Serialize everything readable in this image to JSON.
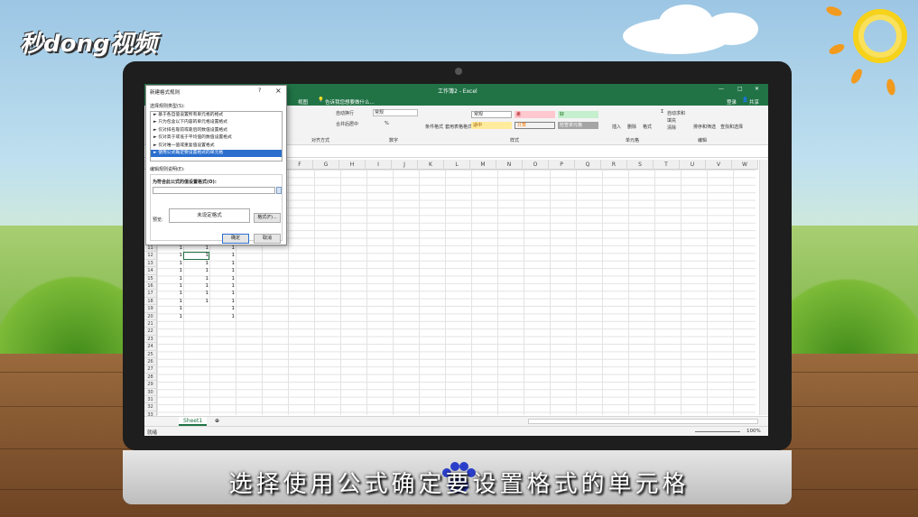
{
  "brand": {
    "logo_text": "秒dong视频"
  },
  "subtitle": "选择使用公式确定要设置格式的单元格",
  "excel": {
    "window_title": "工作簿2 - Excel",
    "ribbon_tab_visible": "视图",
    "tell_me": "告诉我您想要做什么...",
    "login": "登录",
    "share": "共享",
    "groups": {
      "alignment": "对齐方式",
      "number": "数字",
      "styles": "样式",
      "cells": "单元格",
      "editing": "编辑"
    },
    "alignment_items": [
      "自动换行",
      "合并后居中"
    ],
    "number_format": "常规",
    "style_buttons": {
      "conditional": "条件格式",
      "table": "套用表格格式",
      "normal": "常规",
      "bad": "差",
      "good": "好",
      "neutral": "适中",
      "calc": "计算",
      "check": "检查单元格"
    },
    "cells_buttons": [
      "插入",
      "删除",
      "格式"
    ],
    "editing_buttons": [
      "自动求和",
      "填充",
      "清除",
      "排序和筛选",
      "查找和选择"
    ],
    "columns": [
      "F",
      "G",
      "H",
      "I",
      "J",
      "K",
      "L",
      "M",
      "N",
      "O",
      "P",
      "Q",
      "R",
      "S",
      "T",
      "U",
      "V",
      "W"
    ],
    "rows": [
      "11",
      "12",
      "13",
      "14",
      "15",
      "16",
      "17",
      "18",
      "19",
      "20",
      "21",
      "22",
      "23",
      "24",
      "25",
      "26",
      "27",
      "28",
      "29",
      "30",
      "31",
      "32",
      "33"
    ],
    "cell_values": {
      "col_a": [
        "1",
        "1",
        "1",
        "1",
        "1",
        "1",
        "1",
        "1",
        "1",
        "1"
      ],
      "col_b": [
        "1",
        "1",
        "1",
        "1",
        "1",
        "1",
        "1",
        "1",
        "",
        ""
      ],
      "col_c": [
        "1",
        "1",
        "1",
        "1",
        "1",
        "1",
        "1",
        "1",
        "1",
        "1"
      ]
    },
    "sheet_tab": "Sheet1",
    "status_left": "就绪",
    "zoom": "100%"
  },
  "dialog": {
    "title": "新建格式规则",
    "help": "?",
    "close": "×",
    "select_type_label": "选择规则类型(S):",
    "rule_types": [
      "► 基于各自值设置所有单元格的格式",
      "► 只为包含以下内容的单元格设置格式",
      "► 仅对排名靠前或靠后的数值设置格式",
      "► 仅对高于或低于平均值的数值设置格式",
      "► 仅对唯一值或重复值设置格式",
      "► 使用公式确定要设置格式的单元格"
    ],
    "selected_index": 5,
    "edit_desc_label": "编辑规则说明(E):",
    "formula_label": "为符合此公式的值设置格式(O):",
    "preview_label": "预览:",
    "preview_text": "未设定格式",
    "format_button": "格式(F)...",
    "ok": "确定",
    "cancel": "取消"
  },
  "colors": {
    "excel_green": "#217346",
    "selection_blue": "#2a6fce",
    "subtitle_white": "#ffffff"
  }
}
